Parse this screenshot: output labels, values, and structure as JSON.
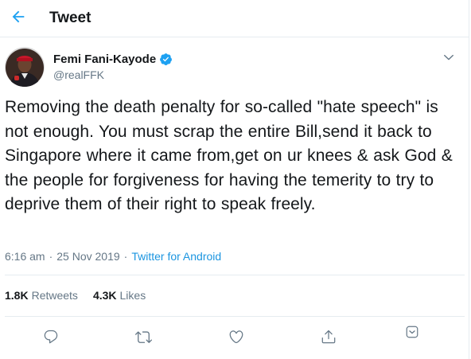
{
  "header": {
    "title": "Tweet",
    "back_icon": "arrow-left-icon"
  },
  "tweet": {
    "author": {
      "display_name": "Femi Fani-Kayode",
      "handle": "@realFFK",
      "verified": true
    },
    "text": "Removing the death penalty for so-called \"hate speech\" is not enough. You must scrap the entire Bill,send it back to Singapore where it came from,get on ur knees & ask God & the people for forgiveness for having the temerity to try to deprive them of their right to speak freely.",
    "time": "6:16 am",
    "date": "25 Nov 2019",
    "separator": "·",
    "source": "Twitter for Android",
    "stats": {
      "retweets_count": "1.8K",
      "retweets_label": "Retweets",
      "likes_count": "4.3K",
      "likes_label": "Likes"
    }
  },
  "actions": [
    {
      "name": "reply",
      "icon": "speech-bubble-icon"
    },
    {
      "name": "retweet",
      "icon": "retweet-arrows-icon"
    },
    {
      "name": "like",
      "icon": "heart-icon"
    },
    {
      "name": "share",
      "icon": "share-upload-icon"
    },
    {
      "name": "more",
      "icon": "chevron-down-icon"
    }
  ],
  "colors": {
    "accent": "#1da1f2",
    "link": "#1b95e0",
    "text_primary": "#14171a",
    "text_secondary": "#657786",
    "border": "#e6ecf0"
  }
}
